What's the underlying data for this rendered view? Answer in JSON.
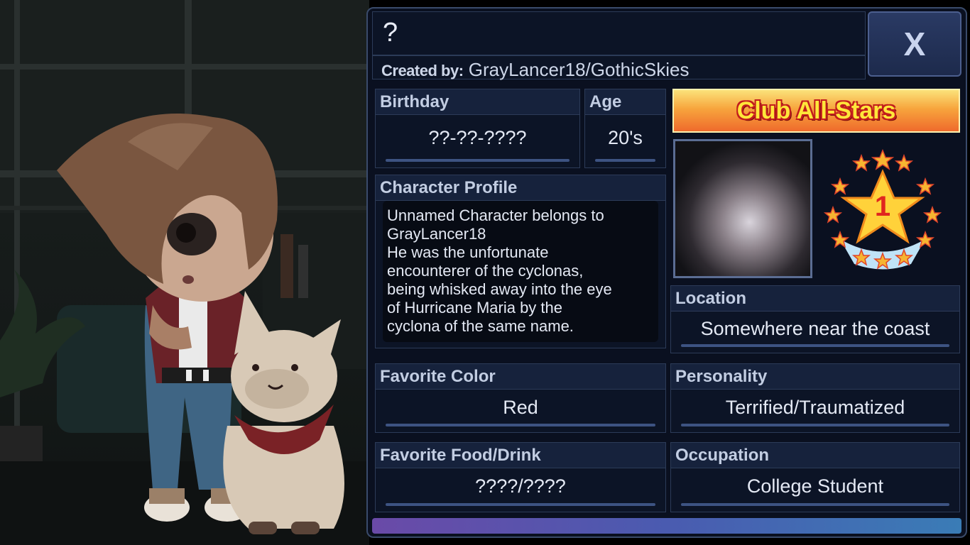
{
  "title": "?",
  "created_by": {
    "label": "Created by:",
    "value": "GrayLancer18/GothicSkies"
  },
  "close_label": "X",
  "fields": {
    "birthday": {
      "label": "Birthday",
      "value": "??-??-????"
    },
    "age": {
      "label": "Age",
      "value": "20's"
    },
    "character_profile": {
      "label": "Character Profile",
      "value": "Unnamed Character belongs to\nGrayLancer18\nHe was the unfortunate\nencounterer of the cyclonas,\nbeing whisked away into the eye\nof Hurricane Maria by the\ncyclona of the same name."
    },
    "location": {
      "label": "Location",
      "value": "Somewhere near the coast"
    },
    "favorite_color": {
      "label": "Favorite Color",
      "value": "Red"
    },
    "personality": {
      "label": "Personality",
      "value": "Terrified/Traumatized"
    },
    "favorite_food": {
      "label": "Favorite Food/Drink",
      "value": "????/????"
    },
    "occupation": {
      "label": "Occupation",
      "value": "College Student"
    }
  },
  "banner": {
    "text": "Club All-Stars",
    "badge_number": "1"
  },
  "colors": {
    "panel_bg": "#0a1020",
    "panel_border": "#3a4b6b",
    "field_label_bg": "#16223c",
    "underline": "#3d5382",
    "banner_text": "#ffe63a"
  }
}
